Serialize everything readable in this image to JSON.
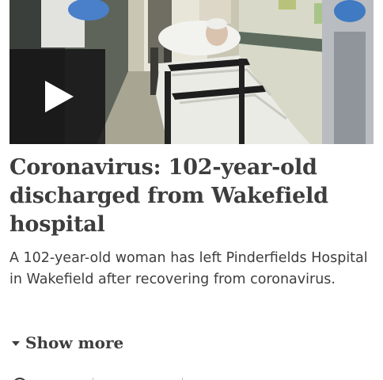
{
  "video": {
    "play_label": "Play video",
    "description_hidden": ""
  },
  "article": {
    "headline": "Coronavirus: 102-year-old discharged from Wakefield hospital",
    "summary": "A 102-year-old woman has left Pinderfields Hospital in Wakefield after recovering from coronavirus.",
    "show_more_label": "Show more"
  },
  "colors": {
    "text": "#3d3d3d",
    "play_box": "#141414"
  },
  "icons": {
    "play": "play-icon",
    "expand": "caret-down-icon",
    "meta": "clock-icon"
  }
}
